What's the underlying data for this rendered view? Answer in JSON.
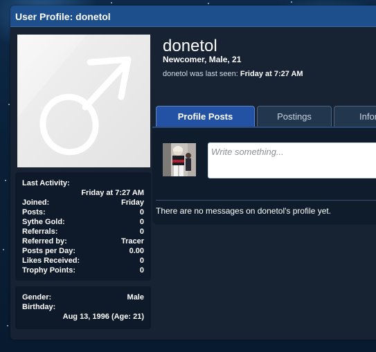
{
  "header": {
    "title": "User Profile: donetol"
  },
  "profile": {
    "username": "donetol",
    "user_title": "Newcomer, Male, 21",
    "last_seen_prefix": "donetol was last seen:",
    "last_seen_value": "Friday at 7:27 AM"
  },
  "stats": {
    "last_activity_label": "Last Activity:",
    "last_activity_value": "Friday at 7:27 AM",
    "rows": [
      {
        "label": "Joined:",
        "value": "Friday"
      },
      {
        "label": "Posts:",
        "value": "0"
      },
      {
        "label": "Sythe Gold:",
        "value": "0"
      },
      {
        "label": "Referrals:",
        "value": "0"
      },
      {
        "label": "Referred by:",
        "value": "Tracer"
      },
      {
        "label": "Posts per Day:",
        "value": "0.00"
      },
      {
        "label": "Likes Received:",
        "value": "0"
      },
      {
        "label": "Trophy Points:",
        "value": "0"
      }
    ]
  },
  "meta": {
    "gender_label": "Gender:",
    "gender_value": "Male",
    "birthday_label": "Birthday:",
    "birthday_value": "Aug 13, 1996 (Age: 21)"
  },
  "tabs": [
    {
      "label": "Profile Posts"
    },
    {
      "label": "Postings"
    },
    {
      "label": "Infor"
    }
  ],
  "status": {
    "placeholder": "Write something..."
  },
  "posts": {
    "empty_message": "There are no messages on donetol's profile yet."
  },
  "colors": {
    "header": "#1d4f8c",
    "active_tab": "#2352a5",
    "card": "#0e1a29",
    "body": "#172233"
  }
}
